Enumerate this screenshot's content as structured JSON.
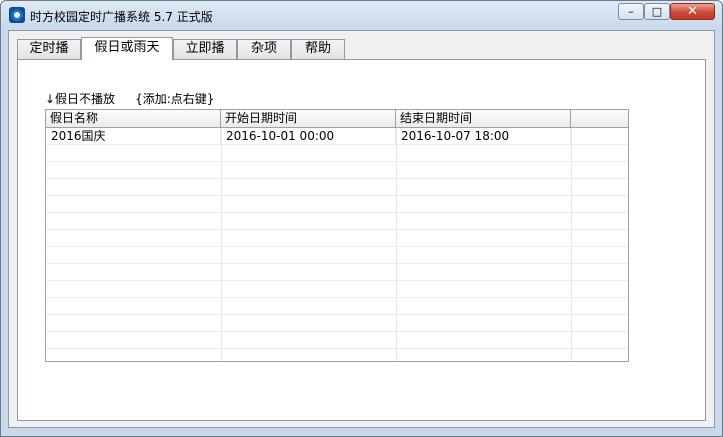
{
  "window": {
    "title": "时方校园定时广播系统 5.7 正式版"
  },
  "controls": {
    "minimize": "–",
    "maximize": "□",
    "close": "✕"
  },
  "tabs": [
    {
      "label": "定时播",
      "active": false
    },
    {
      "label": "假日或雨天",
      "active": true
    },
    {
      "label": "立即播",
      "active": false
    },
    {
      "label": "杂项",
      "active": false
    },
    {
      "label": "帮助",
      "active": false
    }
  ],
  "hint": {
    "no_play": "↓假日不播放",
    "add_hint": "{添加:点右键}"
  },
  "table": {
    "columns": [
      "假日名称",
      "开始日期时间",
      "结束日期时间",
      ""
    ],
    "rows": [
      {
        "name": "2016国庆",
        "start": "2016-10-01 00:00",
        "end": "2016-10-07 18:00",
        "extra": ""
      }
    ]
  }
}
